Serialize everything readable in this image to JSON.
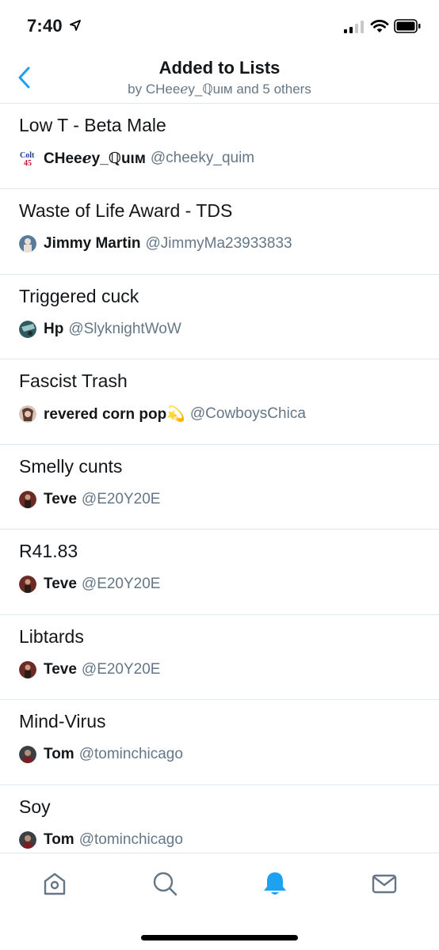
{
  "status_bar": {
    "time": "7:40"
  },
  "header": {
    "title": "Added to Lists",
    "subtitle": "by CHeeℯy_ℚuιм and 5 others"
  },
  "lists": [
    {
      "title": "Low T - Beta Male",
      "owner_name": "CHeeℯy_ℚuιм",
      "owner_handle": "@cheeky_quim"
    },
    {
      "title": "Waste of Life Award - TDS",
      "owner_name": "Jimmy Martin",
      "owner_handle": "@JimmyMa23933833"
    },
    {
      "title": "Triggered cuck",
      "owner_name": "Hp",
      "owner_handle": "@SlyknightWoW"
    },
    {
      "title": "Fascist Trash",
      "owner_name": "revered corn pop💫",
      "owner_handle": "@CowboysChica"
    },
    {
      "title": "Smelly cunts",
      "owner_name": "Teve",
      "owner_handle": "@E20Y20E"
    },
    {
      "title": "R41.83",
      "owner_name": "Teve",
      "owner_handle": "@E20Y20E"
    },
    {
      "title": "Libtards",
      "owner_name": "Teve",
      "owner_handle": "@E20Y20E"
    },
    {
      "title": "Mind-Virus",
      "owner_name": "Tom",
      "owner_handle": "@tominchicago"
    },
    {
      "title": "Soy",
      "owner_name": "Tom",
      "owner_handle": "@tominchicago"
    }
  ],
  "tab_bar": {
    "items": [
      "home-icon",
      "search-icon",
      "notifications-icon",
      "messages-icon"
    ],
    "active": "notifications-icon"
  },
  "colors": {
    "accent": "#1da1f2",
    "muted": "#657786",
    "divider": "#e1e8ed",
    "inactive_icon": "#657786"
  }
}
